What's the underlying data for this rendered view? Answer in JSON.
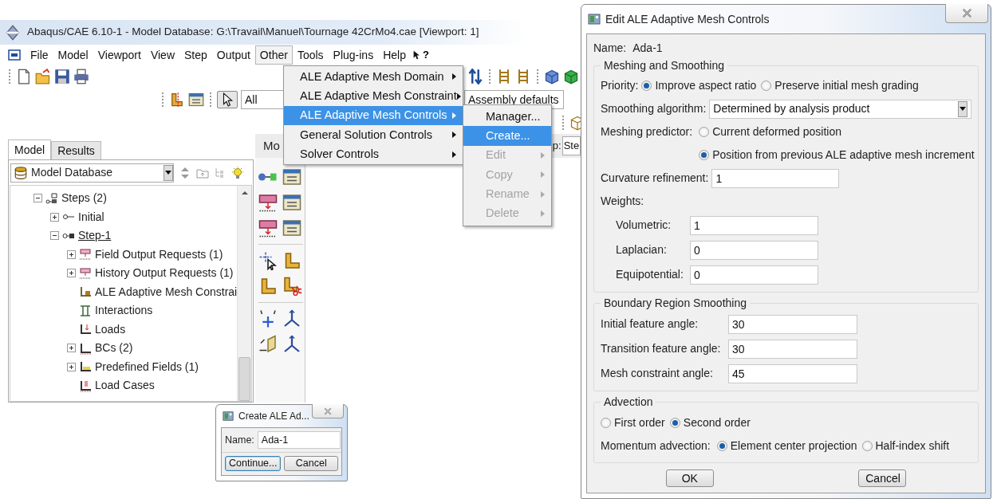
{
  "window": {
    "title": "Abaqus/CAE 6.10-1 - Model Database: G:\\Travail\\Manuel\\Tournage 42CrMo4.cae [Viewport: 1]"
  },
  "menubar": {
    "items": [
      {
        "label": "File",
        "selected": false
      },
      {
        "label": "Model",
        "selected": false
      },
      {
        "label": "Viewport",
        "selected": false
      },
      {
        "label": "View",
        "selected": false
      },
      {
        "label": "Step",
        "selected": false
      },
      {
        "label": "Output",
        "selected": false
      },
      {
        "label": "Other",
        "selected": true
      },
      {
        "label": "Tools",
        "selected": false
      },
      {
        "label": "Plug-ins",
        "selected": false
      },
      {
        "label": "Help",
        "selected": false
      }
    ],
    "whats_this": "?"
  },
  "toolbar": {
    "selection_filter": "All",
    "render_style": "Assembly defaults"
  },
  "context_bar": {
    "module_label": "Mo",
    "step_label": "p:",
    "step_value": "Ste"
  },
  "left_tabs": [
    {
      "label": "Model",
      "selected": true
    },
    {
      "label": "Results",
      "selected": false
    }
  ],
  "tree_source": "Model Database",
  "tree": [
    {
      "label": "Steps (2)",
      "expanded": true,
      "current": false,
      "children": [
        {
          "label": "Initial",
          "expanded": false,
          "current": false
        },
        {
          "label": "Step-1",
          "expanded": true,
          "current": true,
          "children": [
            {
              "label": "Field Output Requests (1)",
              "expanded": false,
              "current": false
            },
            {
              "label": "History Output Requests (1)",
              "expanded": false,
              "current": false
            },
            {
              "label": "ALE Adaptive Mesh Constrai",
              "current": false
            },
            {
              "label": "Interactions",
              "current": false
            },
            {
              "label": "Loads",
              "current": false
            },
            {
              "label": "BCs (2)",
              "expanded": false,
              "current": false
            },
            {
              "label": "Predefined Fields (1)",
              "expanded": false,
              "current": false
            },
            {
              "label": "Load Cases",
              "current": false
            }
          ]
        }
      ]
    }
  ],
  "other_menu": [
    {
      "label": "ALE Adaptive Mesh Domain",
      "selected": false
    },
    {
      "label": "ALE Adaptive Mesh Constraint",
      "selected": false
    },
    {
      "label": "ALE Adaptive Mesh Controls",
      "selected": true
    },
    {
      "label": "General Solution Controls",
      "selected": false
    },
    {
      "label": "Solver Controls",
      "selected": false
    }
  ],
  "controls_submenu": [
    {
      "label": "Manager...",
      "selected": false,
      "disabled": false,
      "submenu": false
    },
    {
      "label": "Create...",
      "selected": true,
      "disabled": false,
      "submenu": false
    },
    {
      "label": "Edit",
      "selected": false,
      "disabled": true,
      "submenu": true
    },
    {
      "label": "Copy",
      "selected": false,
      "disabled": true,
      "submenu": true
    },
    {
      "label": "Rename",
      "selected": false,
      "disabled": true,
      "submenu": true
    },
    {
      "label": "Delete",
      "selected": false,
      "disabled": true,
      "submenu": true
    }
  ],
  "create_dialog": {
    "title": "Create ALE Ad...",
    "name_label": "Name:",
    "name_value": "Ada-1",
    "buttons": [
      "Continue...",
      "Cancel"
    ]
  },
  "edit_dialog": {
    "title": "Edit ALE Adaptive Mesh Controls",
    "name_label": "Name:",
    "name_value": "Ada-1",
    "meshing": {
      "title": "Meshing and Smoothing",
      "priority": {
        "label": "Priority:",
        "options": [
          {
            "label": "Improve aspect ratio",
            "selected": true
          },
          {
            "label": "Preserve initial mesh grading",
            "selected": false
          }
        ]
      },
      "smoothing": {
        "label": "Smoothing algorithm:",
        "value": "Determined by analysis product"
      },
      "predictor": {
        "label": "Meshing predictor:",
        "options": [
          {
            "label": "Current deformed position",
            "selected": false
          },
          {
            "label": "Position from previous ALE adaptive mesh increment",
            "selected": true
          }
        ]
      },
      "curvature": {
        "label": "Curvature refinement:",
        "value": "1"
      },
      "weights": {
        "label": "Weights:",
        "fields": [
          {
            "label": "Volumetric:",
            "value": "1"
          },
          {
            "label": "Laplacian:",
            "value": "0"
          },
          {
            "label": "Equipotential:",
            "value": "0"
          }
        ]
      }
    },
    "boundary": {
      "title": "Boundary Region Smoothing",
      "fields": [
        {
          "label": "Initial feature angle:",
          "value": "30"
        },
        {
          "label": "Transition feature angle:",
          "value": "30"
        },
        {
          "label": "Mesh constraint angle:",
          "value": "45"
        }
      ]
    },
    "advection": {
      "title": "Advection",
      "order": [
        {
          "label": "First order",
          "selected": false
        },
        {
          "label": "Second order",
          "selected": true
        }
      ],
      "momentum": {
        "label": "Momentum advection:",
        "options": [
          {
            "label": "Element center projection",
            "selected": true
          },
          {
            "label": "Half-index shift",
            "selected": false
          }
        ]
      }
    },
    "buttons": [
      "OK",
      "Cancel"
    ]
  }
}
